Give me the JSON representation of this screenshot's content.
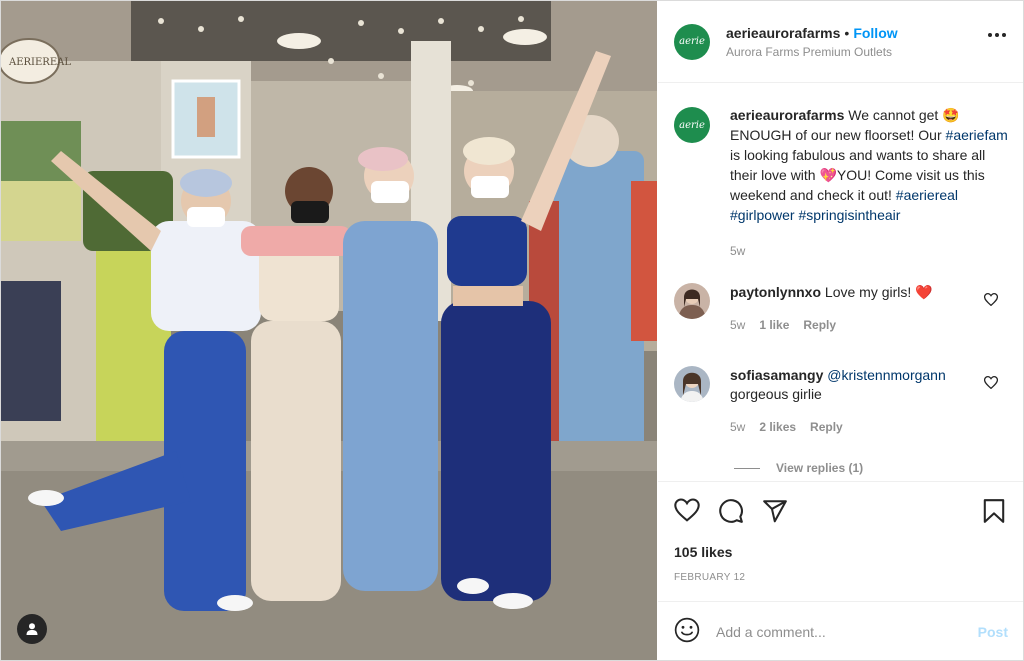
{
  "post": {
    "account": "aerieaurorafarms",
    "logo_text": "aerie",
    "follow_label": "Follow",
    "location": "Aurora Farms Premium Outlets",
    "store_sign": "AERIEREAL",
    "caption": {
      "username": "aerieaurorafarms",
      "text_1": "We cannot get ",
      "emoji_1": "🤩",
      "text_2": "ENOUGH of our new floorset! Our",
      "hashtag_1": "#aeriefam",
      "text_3": " is looking fabulous and wants to share all their love with ",
      "emoji_2": "💖",
      "text_4": "YOU! Come visit us this weekend and check it out!",
      "hashtag_2": "#aeriereal",
      "hashtag_3": "#girlpower",
      "hashtag_4": "#springisintheair",
      "time": "5w"
    },
    "comments": [
      {
        "username": "paytonlynnxo",
        "text": "Love my girls!",
        "emoji": "❤️",
        "time": "5w",
        "likes": "1 like",
        "reply_label": "Reply"
      },
      {
        "username": "sofiasamangy",
        "mention": "@kristennmorgann",
        "text": "gorgeous girlie",
        "time": "5w",
        "likes": "2 likes",
        "reply_label": "Reply",
        "view_replies": "View replies (1)"
      }
    ],
    "likes_count": "105 likes",
    "date": "FEBRUARY 12",
    "add_comment_placeholder": "Add a comment...",
    "post_label": "Post"
  },
  "colors": {
    "brand_green": "#1e8d4e",
    "link_blue": "#0095f6",
    "hashtag_blue": "#00376b",
    "heart_red": "#ed4956",
    "post_disabled": "#b2dffc"
  },
  "icons": {
    "more": "more-options-icon",
    "like": "heart-icon",
    "comment": "comment-bubble-icon",
    "share": "paper-plane-icon",
    "save": "bookmark-icon",
    "emoji": "smiley-icon",
    "user_tags": "user-tag-icon"
  }
}
